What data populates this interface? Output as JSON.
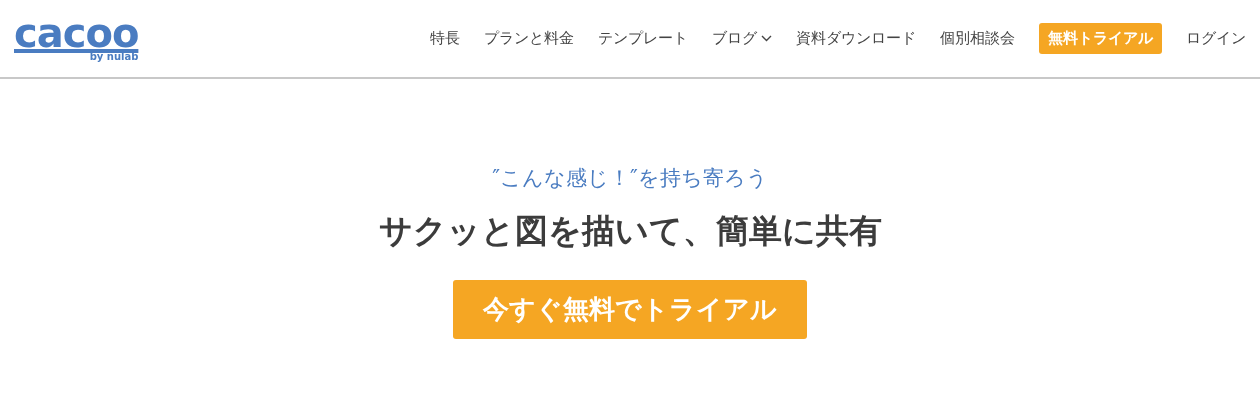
{
  "logo": {
    "name": "cacoo",
    "byline": "by nulab"
  },
  "nav": [
    {
      "label": "特長",
      "kind": "link"
    },
    {
      "label": "プランと料金",
      "kind": "link"
    },
    {
      "label": "テンプレート",
      "kind": "link"
    },
    {
      "label": "ブログ",
      "kind": "dropdown"
    },
    {
      "label": "資料ダウンロード",
      "kind": "link"
    },
    {
      "label": "個別相談会",
      "kind": "link"
    },
    {
      "label": "無料トライアル",
      "kind": "cta"
    },
    {
      "label": "ログイン",
      "kind": "link"
    }
  ],
  "hero": {
    "tagline": "″こんな感じ！″を持ち寄ろう",
    "headline": "サクッと図を描いて、簡単に共有",
    "cta": "今すぐ無料でトライアル"
  }
}
